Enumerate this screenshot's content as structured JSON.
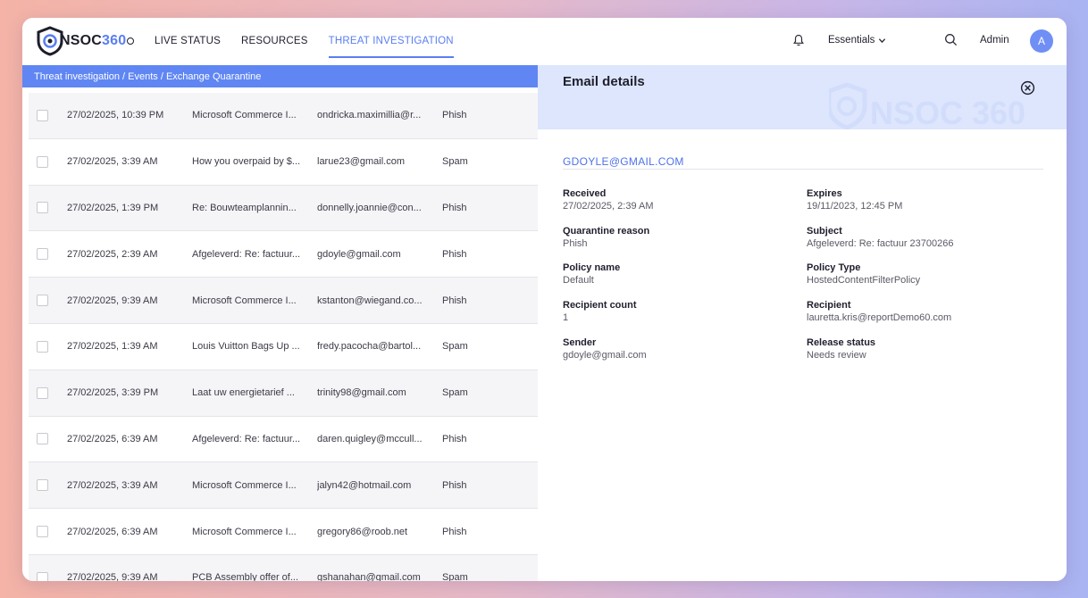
{
  "header": {
    "logo_text": "NSOC",
    "logo_number": "360",
    "nav": [
      "LIVE STATUS",
      "RESOURCES",
      "THREAT INVESTIGATION"
    ],
    "plan": "Essentials",
    "user": "Admin",
    "avatar_initial": "A"
  },
  "breadcrumb": "Threat investigation / Events / Exchange Quarantine",
  "rows": [
    {
      "date": "27/02/2025, 10:39 PM",
      "subject": "Microsoft Commerce I...",
      "sender": "ondricka.maximillia@r...",
      "type": "Phish"
    },
    {
      "date": "27/02/2025, 3:39 AM",
      "subject": "How you overpaid by $...",
      "sender": "larue23@gmail.com",
      "type": "Spam"
    },
    {
      "date": "27/02/2025, 1:39 PM",
      "subject": "Re: Bouwteamplannin...",
      "sender": "donnelly.joannie@con...",
      "type": "Phish"
    },
    {
      "date": "27/02/2025, 2:39 AM",
      "subject": "Afgeleverd: Re: factuur...",
      "sender": "gdoyle@gmail.com",
      "type": "Phish"
    },
    {
      "date": "27/02/2025, 9:39 AM",
      "subject": "Microsoft Commerce I...",
      "sender": "kstanton@wiegand.co...",
      "type": "Phish"
    },
    {
      "date": "27/02/2025, 1:39 AM",
      "subject": "Louis Vuitton Bags Up ...",
      "sender": "fredy.pacocha@bartol...",
      "type": "Spam"
    },
    {
      "date": "27/02/2025, 3:39 PM",
      "subject": "Laat uw energietarief ...",
      "sender": "trinity98@gmail.com",
      "type": "Spam"
    },
    {
      "date": "27/02/2025, 6:39 AM",
      "subject": "Afgeleverd: Re: factuur...",
      "sender": "daren.quigley@mccull...",
      "type": "Phish"
    },
    {
      "date": "27/02/2025, 3:39 AM",
      "subject": "Microsoft Commerce I...",
      "sender": "jalyn42@hotmail.com",
      "type": "Phish"
    },
    {
      "date": "27/02/2025, 6:39 AM",
      "subject": "Microsoft Commerce I...",
      "sender": "gregory86@roob.net",
      "type": "Phish"
    },
    {
      "date": "27/02/2025, 9:39 AM",
      "subject": "PCB Assembly offer of...",
      "sender": "gshanahan@gmail.com",
      "type": "Spam"
    }
  ],
  "details": {
    "title": "Email details",
    "email": "GDOYLE@GMAIL.COM",
    "watermark": "NSOC 360",
    "fields": [
      {
        "label": "Received",
        "value": "27/02/2025, 2:39 AM"
      },
      {
        "label": "Expires",
        "value": "19/11/2023, 12:45 PM"
      },
      {
        "label": "Quarantine reason",
        "value": "Phish"
      },
      {
        "label": "Subject",
        "value": "Afgeleverd: Re: factuur 23700266"
      },
      {
        "label": "Policy name",
        "value": "Default"
      },
      {
        "label": "Policy Type",
        "value": "HostedContentFilterPolicy"
      },
      {
        "label": "Recipient count",
        "value": "1"
      },
      {
        "label": "Recipient",
        "value": "lauretta.kris@reportDemo60.com"
      },
      {
        "label": "Sender",
        "value": "gdoyle@gmail.com"
      },
      {
        "label": "Release status",
        "value": "Needs review"
      }
    ]
  },
  "colors": {
    "accent": "#5b7ef2",
    "breadcrumb": "#5f86f3",
    "panel_head": "#dde6fc"
  }
}
